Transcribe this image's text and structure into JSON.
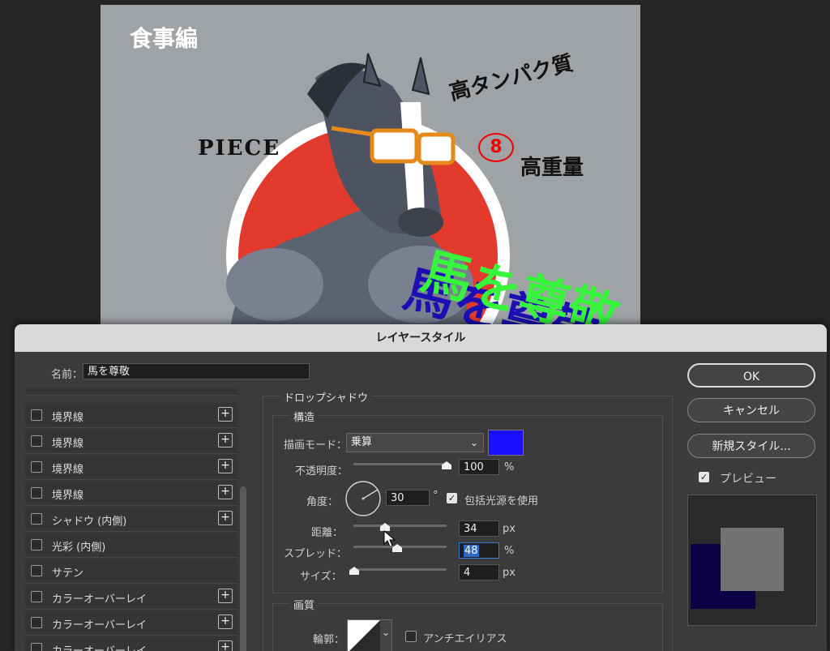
{
  "canvas": {
    "label_meal": "食事編",
    "label_protein": "高タンパク質",
    "label_piece": "PIECE",
    "badge_number": "8",
    "label_heavy": "高重量",
    "headline": "馬を尊敬"
  },
  "dialog": {
    "title": "レイヤースタイル",
    "name_label": "名前：",
    "name_value": "馬を尊敬",
    "style_items": [
      {
        "label": "境界線",
        "plus": "+"
      },
      {
        "label": "境界線",
        "plus": "+"
      },
      {
        "label": "境界線",
        "plus": "+"
      },
      {
        "label": "境界線",
        "plus": "+"
      },
      {
        "label": "シャドウ (内側)",
        "plus": "+"
      },
      {
        "label": "光彩 (内側)",
        "plus": ""
      },
      {
        "label": "サテン",
        "plus": ""
      },
      {
        "label": "カラーオーバーレイ",
        "plus": "+"
      },
      {
        "label": "カラーオーバーレイ",
        "plus": "+"
      },
      {
        "label": "カラーオーバーレイ",
        "plus": "+"
      }
    ],
    "drop_shadow": {
      "section_title": "ドロップシャドウ",
      "structure_title": "構造",
      "blend_mode_label": "描画モード：",
      "blend_mode_value": "乗算",
      "shadow_color": "#1a10ff",
      "opacity_label": "不透明度：",
      "opacity_value": "100",
      "opacity_unit": "%",
      "angle_label": "角度：",
      "angle_value": "30",
      "angle_unit": "°",
      "global_light_label": "包括光源を使用",
      "distance_label": "距離：",
      "distance_value": "34",
      "distance_unit": "px",
      "spread_label": "スプレッド：",
      "spread_value": "48",
      "spread_unit": "%",
      "size_label": "サイズ：",
      "size_value": "4",
      "size_unit": "px",
      "quality_title": "画質",
      "contour_label": "輪郭：",
      "antialias_label": "アンチエイリアス"
    },
    "buttons": {
      "ok": "OK",
      "cancel": "キャンセル",
      "new_style": "新規スタイル...",
      "preview": "プレビュー"
    }
  }
}
